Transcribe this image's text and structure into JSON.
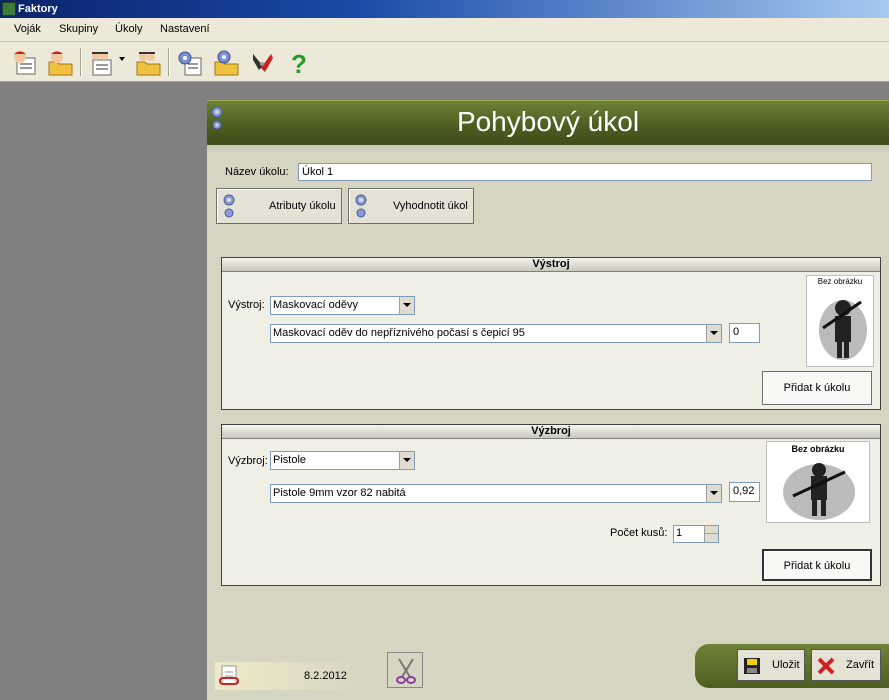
{
  "window": {
    "title": "Faktory"
  },
  "menu": {
    "items": [
      "Voják",
      "Skupiny",
      "Úkoly",
      "Nastavení"
    ]
  },
  "toolbar": {
    "icons": [
      "soldier-card-icon",
      "soldier-folder-icon",
      "group-card-icon",
      "group-folder-icon",
      "task-card-icon",
      "task-folder-icon",
      "tools-icon",
      "help-icon"
    ]
  },
  "form": {
    "heading": "Pohybový úkol",
    "name_label": "Název úkolu:",
    "name_value": "Úkol 1",
    "attr_button": "Atributy úkolu",
    "eval_button": "Vyhodnotit úkol"
  },
  "vystroj": {
    "title": "Výstroj",
    "label": "Výstroj:",
    "category": "Maskovací oděvy",
    "item": "Maskovací oděv do nepříznivého počasí s čepicí 95",
    "value": "0",
    "image_text": "Bez obrázku",
    "add_button": "Přidat k úkolu"
  },
  "vyzbroj": {
    "title": "Výzbroj",
    "label": "Výzbroj:",
    "category": "Pistole",
    "item": "Pistole 9mm vzor 82 nabitá",
    "value": "0,92",
    "count_label": "Počet kusů:",
    "count_value": "1",
    "image_text": "Bez obrázku",
    "add_button": "Přidat k úkolu"
  },
  "footer": {
    "date": "8.2.2012",
    "save": "Uložit",
    "close": "Zavřít"
  },
  "colors": {
    "accent_green": "#4d5e22",
    "panel": "#d6d5c2"
  }
}
